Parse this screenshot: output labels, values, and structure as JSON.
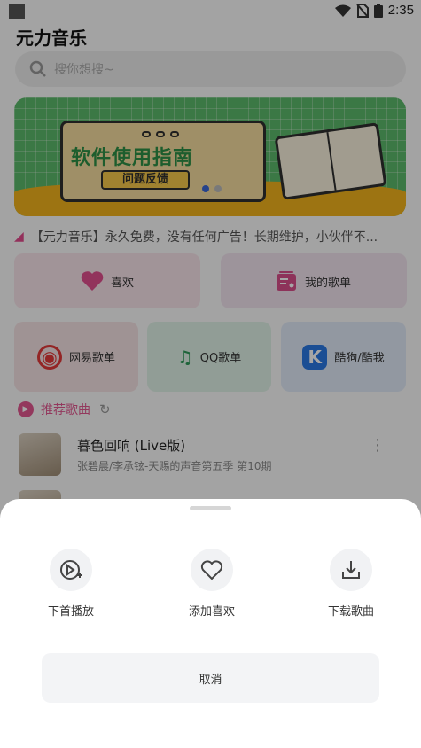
{
  "status_bar": {
    "time": "2:35"
  },
  "app": {
    "title": "元力音乐"
  },
  "search": {
    "placeholder": "搜你想搜~"
  },
  "banner": {
    "title": "软件使用指南",
    "subtitle": "问题反馈"
  },
  "notice": {
    "text": "【元力音乐】永久免费，没有任何广告！长期维护，小伙伴不..."
  },
  "quick_cards": [
    {
      "label": "喜欢",
      "icon": "heart-icon"
    },
    {
      "label": "我的歌单",
      "icon": "playlist-icon"
    }
  ],
  "platform_cards": [
    {
      "label": "网易歌单",
      "icon": "netease-icon"
    },
    {
      "label": "QQ歌单",
      "icon": "qq-music-icon"
    },
    {
      "label": "酷狗/酷我",
      "icon": "kugou-icon"
    }
  ],
  "recommend": {
    "label": "推荐歌曲"
  },
  "songs": [
    {
      "title": "暮色回响 (Live版)",
      "subtitle": "张碧晨/李承铉-天赐的声音第五季 第10期"
    }
  ],
  "sheet": {
    "actions": [
      {
        "label": "下首播放",
        "icon": "play-next-icon"
      },
      {
        "label": "添加喜欢",
        "icon": "heart-outline-icon"
      },
      {
        "label": "下载歌曲",
        "icon": "download-icon"
      }
    ],
    "cancel_label": "取消"
  },
  "colors": {
    "accent": "#e2568f",
    "overlay": "rgba(0,0,0,0.35)"
  }
}
